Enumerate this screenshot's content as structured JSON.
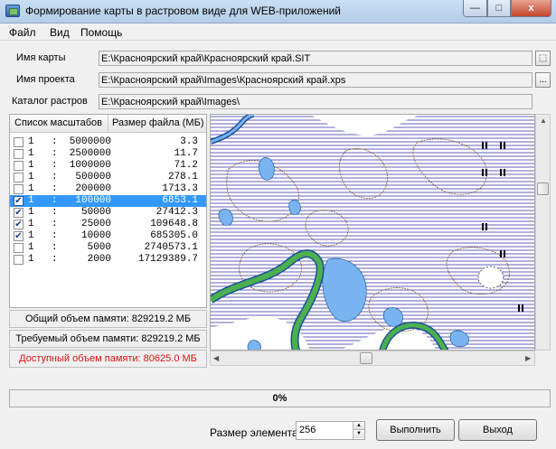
{
  "window": {
    "title": "Формирование карты в растровом виде для WEB-приложений",
    "min_label": "—",
    "max_label": "□",
    "close_label": "x"
  },
  "menu": [
    "Файл",
    "Вид",
    "Помощь"
  ],
  "fields": {
    "map": {
      "label": "Имя карты",
      "value": "E:\\Красноярский край\\Красноярский край.SIT",
      "button": "⬚"
    },
    "project": {
      "label": "Имя проекта",
      "value": "E:\\Красноярский край\\Images\\Красноярский край.xps",
      "button": "..."
    },
    "catalog": {
      "label": "Каталог растров",
      "value": "E:\\Красноярский край\\Images\\"
    }
  },
  "scales": {
    "headers": {
      "scale": "Список масштабов",
      "size": "Размер файла (МБ)"
    },
    "rows": [
      {
        "one": "1",
        "colon": ":",
        "scale": "5000000",
        "size": "3.3",
        "checked": false,
        "selected": false
      },
      {
        "one": "1",
        "colon": ":",
        "scale": "2500000",
        "size": "11.7",
        "checked": false,
        "selected": false
      },
      {
        "one": "1",
        "colon": ":",
        "scale": "1000000",
        "size": "71.2",
        "checked": false,
        "selected": false
      },
      {
        "one": "1",
        "colon": ":",
        "scale": "500000",
        "size": "278.1",
        "checked": false,
        "selected": false
      },
      {
        "one": "1",
        "colon": ":",
        "scale": "200000",
        "size": "1713.3",
        "checked": false,
        "selected": false
      },
      {
        "one": "1",
        "colon": ":",
        "scale": "100000",
        "size": "6853.1",
        "checked": true,
        "selected": true
      },
      {
        "one": "1",
        "colon": ":",
        "scale": "50000",
        "size": "27412.3",
        "checked": true,
        "selected": false
      },
      {
        "one": "1",
        "colon": ":",
        "scale": "25000",
        "size": "109648.8",
        "checked": true,
        "selected": false
      },
      {
        "one": "1",
        "colon": ":",
        "scale": "10000",
        "size": "685305.0",
        "checked": true,
        "selected": false
      },
      {
        "one": "1",
        "colon": ":",
        "scale": "5000",
        "size": "2740573.1",
        "checked": false,
        "selected": false
      },
      {
        "one": "1",
        "colon": ":",
        "scale": "2000",
        "size": "17129389.7",
        "checked": false,
        "selected": false
      }
    ]
  },
  "info": {
    "total": "Общий объем памяти: 829219.2 МБ",
    "required": "Требуемый объем памяти: 829219.2 МБ",
    "available": "Доступный объем памяти: 80625.0 МБ"
  },
  "progress": {
    "text": "0%",
    "value": 0
  },
  "bottom": {
    "element_size_label": "Размер элемента",
    "element_size_value": "256",
    "run_label": "Выполнить",
    "exit_label": "Выход"
  },
  "colors": {
    "water": "#79b4f0",
    "river_green": "#4caf50",
    "contour": "#8b5a2b",
    "hatch": "#2a2aa0",
    "selection": "#3399ff",
    "alert": "#e01010"
  }
}
